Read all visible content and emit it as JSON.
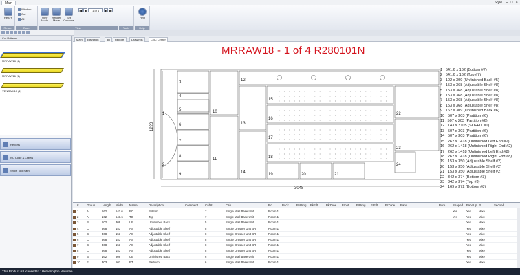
{
  "app": {
    "tab": "Main",
    "style_label": "Style",
    "window_controls": [
      "–",
      "□",
      "×"
    ]
  },
  "ribbon": {
    "groups": [
      {
        "caption": "Return",
        "buttons": [
          "Return"
        ]
      },
      {
        "caption": "Zoom",
        "buttons": [
          "Window",
          "Out",
          "All"
        ]
      },
      {
        "caption": "View",
        "buttons": [
          "View Mode",
          "Render Mode",
          "Set Columns"
        ]
      },
      {
        "caption": "Tools",
        "buttons": []
      },
      {
        "caption": "Help",
        "buttons": [
          "Help"
        ]
      }
    ],
    "page_indicator": "1 of 4"
  },
  "left_panel": {
    "title": "Cut Patterns",
    "parts": [
      "MRRAW18 (4)",
      "MRRAW16 (1)",
      "VENGA X10 (1)"
    ],
    "buttons": [
      "Reports",
      "NC Code & Labels",
      "Show Tool Path"
    ]
  },
  "tabs": [
    "Main",
    "Elevation",
    "3D",
    "Reports",
    "Drawings",
    "CNC Center"
  ],
  "drawing": {
    "title": "MRRAW18 - 1 of 4 R280101N",
    "width_label": "3048",
    "height_label": "1220",
    "part_numbers": [
      "1",
      "2",
      "3",
      "4",
      "5",
      "6",
      "7",
      "8",
      "9",
      "10",
      "11",
      "12",
      "13",
      "14",
      "15",
      "16",
      "17",
      "18",
      "19",
      "20",
      "21",
      "22",
      "23",
      "24"
    ],
    "legend": [
      "1 : 541.6 x 162 (Bottom #7)",
      "2 : 541.6 x 162 (Top #7)",
      "3 : 102 x 309 (Unfinished Back #5)",
      "4 : 153 x 368 (Adjustable Shelf #8)",
      "5 : 153 x 368 (Adjustable Shelf #8)",
      "6 : 153 x 368 (Adjustable Shelf #8)",
      "7 : 153 x 368 (Adjustable Shelf #8)",
      "8 : 153 x 368 (Adjustable Shelf #8)",
      "9 : 162 x 309 (Unfinished Back #6)",
      "10 : 507 x 303 (Partition #6)",
      "11 : 507 x 303 (Partition #6)",
      "12 : 143 x 2105 (SOFFIT #1)",
      "13 : 507 x 303 (Partition #6)",
      "14 : 507 x 303 (Partition #6)",
      "15 : 262 x 1418 (Unfinished Left End #2)",
      "16 : 262 x 1418 (Unfinished Right End #2)",
      "17 : 262 x 1418 (Unfinished Left End #8)",
      "18 : 262 x 1418 (Unfinished Right End #8)",
      "19 : 153 x 350 (Adjustable Shelf #2)",
      "20 : 153 x 350 (Adjustable Shelf #2)",
      "21 : 153 x 350 (Adjustable Shelf #2)",
      "22 : 342 x 374 (Bottom #3)",
      "23 : 342 x 374 (Top #3)",
      "24 : 169 x 372 (Bottom #8)"
    ]
  },
  "grid": {
    "headers": [
      "#",
      "Group",
      "Length",
      "Width",
      "Name",
      "Description",
      "Comment",
      "Cab#",
      "Cab",
      "Ro...",
      "Back",
      "BkProg",
      "BkFilt",
      "BkZone",
      "Front",
      "FrProg",
      "FrFilt",
      "FrZone",
      "Band",
      "Bore",
      "Shaped",
      "FaceUp",
      "Pi...",
      "Second..."
    ],
    "rows": [
      [
        "1",
        "A",
        "162",
        "541.6",
        "BO",
        "Bottom",
        "",
        "7",
        "Single Wall Base Unit",
        "Room 1",
        "",
        "",
        "",
        "",
        "",
        "",
        "",
        "",
        "",
        "",
        "Yes",
        "Yes",
        "Mixe",
        ""
      ],
      [
        "2",
        "A",
        "162",
        "541.6",
        "TO",
        "Top",
        "",
        "7",
        "Single Wall Base Unit",
        "Room 1",
        "",
        "",
        "",
        "",
        "",
        "",
        "",
        "",
        "",
        "",
        "Yes",
        "Yes",
        "Mixe",
        ""
      ],
      [
        "3",
        "B",
        "102",
        "309",
        "UB",
        "Unfinished Back",
        "",
        "5",
        "Single Wall Base Unit",
        "Room 1",
        "",
        "",
        "",
        "",
        "",
        "",
        "",
        "",
        "",
        "",
        "",
        "Yes",
        "Mixe",
        ""
      ],
      [
        "4",
        "C",
        "368",
        "153",
        "AS",
        "Adjustable Shelf",
        "",
        "8",
        "Single Dresser Unit BR",
        "Room 1",
        "",
        "",
        "",
        "",
        "",
        "",
        "",
        "",
        "",
        "",
        "",
        "Yes",
        "Mixe",
        ""
      ],
      [
        "5",
        "C",
        "368",
        "153",
        "AS",
        "Adjustable Shelf",
        "",
        "8",
        "Single Dresser Unit BR",
        "Room 1",
        "",
        "",
        "",
        "",
        "",
        "",
        "",
        "",
        "",
        "",
        "",
        "Yes",
        "Mixe",
        ""
      ],
      [
        "6",
        "C",
        "368",
        "153",
        "AS",
        "Adjustable Shelf",
        "",
        "8",
        "Single Dresser Unit BR",
        "Room 1",
        "",
        "",
        "",
        "",
        "",
        "",
        "",
        "",
        "",
        "",
        "",
        "Yes",
        "Mixe",
        ""
      ],
      [
        "7",
        "C",
        "368",
        "153",
        "AS",
        "Adjustable Shelf",
        "",
        "8",
        "Single Dresser Unit BR",
        "Room 1",
        "",
        "",
        "",
        "",
        "",
        "",
        "",
        "",
        "",
        "",
        "",
        "Yes",
        "Mixe",
        ""
      ],
      [
        "8",
        "C",
        "368",
        "153",
        "AS",
        "Adjustable Shelf",
        "",
        "8",
        "Single Dresser Unit BR",
        "Room 1",
        "",
        "",
        "",
        "",
        "",
        "",
        "",
        "",
        "",
        "",
        "",
        "Yes",
        "Mixe",
        ""
      ],
      [
        "9",
        "B",
        "162",
        "309",
        "UB",
        "Unfinished Back",
        "",
        "6",
        "Single Wall Base Unit",
        "Room 1",
        "",
        "",
        "",
        "",
        "",
        "",
        "",
        "",
        "",
        "",
        "",
        "Yes",
        "Mixe",
        ""
      ],
      [
        "10",
        "E",
        "303",
        "507",
        "PT",
        "Partition",
        "",
        "6",
        "Single Wall Base Unit",
        "Room 1",
        "",
        "",
        "",
        "",
        "",
        "",
        "",
        "",
        "",
        "",
        "",
        "Yes",
        "Mixe",
        ""
      ]
    ]
  },
  "status_text": "This Product is Licensed to : Hetherington Newman",
  "colors": {
    "title_red": "#d4141e",
    "board_yellow": "#f2e23a",
    "status_bg": "#1c2434"
  }
}
